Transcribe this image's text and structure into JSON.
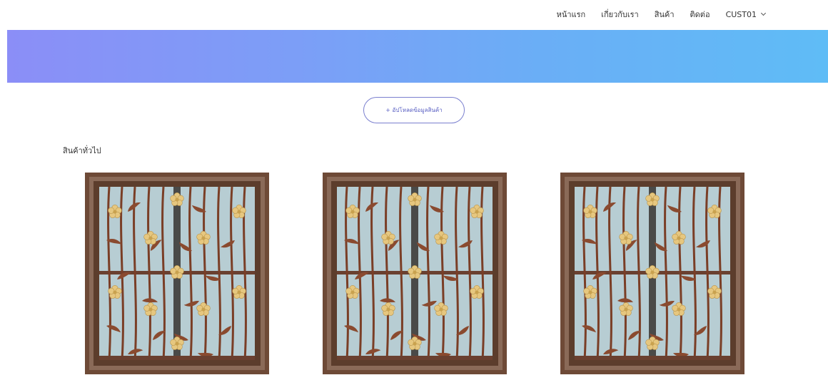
{
  "nav": {
    "items": [
      {
        "label": "หน้าแรก"
      },
      {
        "label": "เกี่ยวกับเรา"
      },
      {
        "label": "สินค้า"
      },
      {
        "label": "ติดต่อ"
      }
    ],
    "user": "CUST01"
  },
  "actions": {
    "upload_label": "+ อัปโหลดข้อมูลสินค้า"
  },
  "section": {
    "title": "สินค้าทั่วไป"
  },
  "products": [
    {
      "image": "window-grille"
    },
    {
      "image": "window-grille"
    },
    {
      "image": "window-grille"
    }
  ],
  "colors": {
    "hero_start": "#8b8ef7",
    "hero_end": "#5fbcf6",
    "accent": "#5c62c4",
    "frame": "#6b4a38",
    "glass": "#b7cdd3",
    "flower": "#e6c77f"
  }
}
